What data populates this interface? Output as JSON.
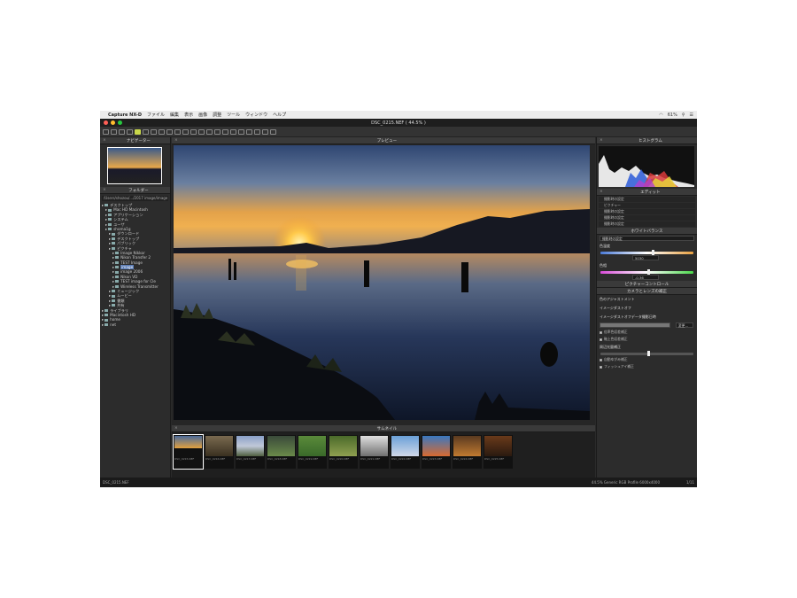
{
  "menubar": {
    "app_name": "Capture NX-D",
    "items": [
      "ファイル",
      "編集",
      "表示",
      "画像",
      "調整",
      "ツール",
      "ウィンドウ",
      "ヘルプ"
    ],
    "status_right": "61%"
  },
  "window": {
    "title": "DSC_0215.NEF ( 44.5% )"
  },
  "left_panel": {
    "navigator_title": "ナビゲーター",
    "folder_title": "フォルダー",
    "path": "/Users/shozou/.../2017 image/image",
    "tree": [
      "デスクトップ",
      "Mac HD Macintosh",
      "アプリケーション",
      "システム",
      "ユーザ",
      "shoma1g",
      "ダウンロード",
      "デスクトップ",
      "パブリック",
      "ピクチャ",
      "Image Nikkor",
      "Nikon Transfer 2",
      "TEST Image",
      "image",
      "image 2006",
      "Nikon VD",
      "TEST image for Cle",
      "Wireless Transmitter",
      "ミュージック",
      "ムービー",
      "書類",
      "共有",
      "ライブラリ",
      "Macintosh HD",
      "home",
      "net"
    ],
    "selected_index": 13
  },
  "preview": {
    "title": "プレビュー"
  },
  "filmstrip": {
    "title": "サムネイル",
    "captions": [
      "DSC_0215.NEF",
      "DSC_0216.NEF",
      "DSC_0217.NEF",
      "DSC_0218.NEF",
      "DSC_0219.NEF",
      "DSC_0220.NEF",
      "DSC_0221.NEF",
      "DSC_0222.NEF",
      "DSC_0223.NEF",
      "DSC_0224.NEF",
      "DSC_0225.NEF"
    ]
  },
  "right_panel": {
    "histogram_title": "ヒストグラム",
    "edit_title": "エディット",
    "edit_rows": [
      "撮影時の設定",
      "ピクチャー",
      "撮影時の設定",
      "撮影時の設定",
      "撮影時の設定"
    ],
    "wb_title": "ホワイトバランス",
    "wb_mode": "撮影時の設定",
    "temp_label": "色温度",
    "temp_value": "5030",
    "tint_label": "色相",
    "tint_value": "-0.36",
    "picture_control_title": "ピクチャーコントロール",
    "lens_title": "カメラとレンズの補正",
    "active_d_label": "色のアジャストメント",
    "dust_label": "イメージダストオフ",
    "dust_ref_label": "イメージダストオフデータ撮影日時",
    "change_button": "変更...",
    "check1": "倍率色収差補正",
    "check2": "軸上色収差補正",
    "vignette_label": "周辺光量補正",
    "auto_distortion": "自動ゆがみ補正",
    "fisheye_label": "フィッシュアイ補正"
  },
  "statusbar": {
    "filename": "DSC_0215.NEF",
    "info": "44.5%   Generic RGB Profile   6000x4000",
    "page": "1/11"
  },
  "colors": {
    "accent": "#c9d84a",
    "selection": "#5a7bb5",
    "sky_top": "#3a4f7a",
    "sun": "#f0a030"
  }
}
